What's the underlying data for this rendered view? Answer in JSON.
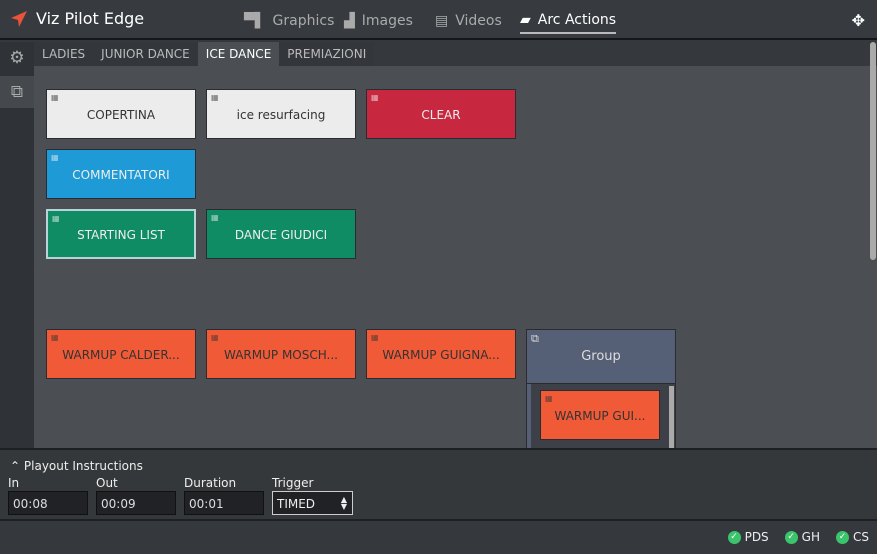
{
  "app": {
    "title": "Viz Pilot Edge",
    "accent": "#e8533a"
  },
  "nav": [
    {
      "label": "Graphics",
      "icon": "graphics-icon"
    },
    {
      "label": "Images",
      "icon": "image-icon"
    },
    {
      "label": "Videos",
      "icon": "film-icon"
    },
    {
      "label": "Arc Actions",
      "icon": "arc-actions-icon",
      "active": true
    }
  ],
  "tabs": [
    {
      "label": "LADIES"
    },
    {
      "label": "JUNIOR DANCE"
    },
    {
      "label": "ICE DANCE",
      "active": true
    },
    {
      "label": "PREMIAZIONI"
    }
  ],
  "buttons": [
    {
      "label": "COPERTINA",
      "color": "#ececec"
    },
    {
      "label": "ice resurfacing",
      "color": "#ececec"
    },
    {
      "label": "CLEAR",
      "color": "#c8283f"
    },
    {
      "label": "COMMENTATORI",
      "color": "#1e9ad6"
    },
    {
      "label": "STARTING LIST",
      "color": "#0f8c63",
      "selected": true
    },
    {
      "label": "DANCE GIUDICI",
      "color": "#0f8c63"
    },
    {
      "label": "WARMUP CALDER...",
      "color": "#f15a37"
    },
    {
      "label": "WARMUP MOSCH...",
      "color": "#f15a37"
    },
    {
      "label": "WARMUP GUIGNA...",
      "color": "#f15a37"
    }
  ],
  "group": {
    "label": "Group",
    "items": [
      {
        "label": "WARMUP GUI...",
        "color": "#f15a37"
      }
    ]
  },
  "playout": {
    "title": "Playout Instructions",
    "in_label": "In",
    "in": "00:08",
    "out_label": "Out",
    "out": "00:09",
    "duration_label": "Duration",
    "duration": "00:01",
    "trigger_label": "Trigger",
    "trigger": "TIMED"
  },
  "status": [
    {
      "label": "PDS",
      "state": "ok"
    },
    {
      "label": "GH",
      "state": "ok"
    },
    {
      "label": "CS",
      "state": "ok"
    }
  ]
}
